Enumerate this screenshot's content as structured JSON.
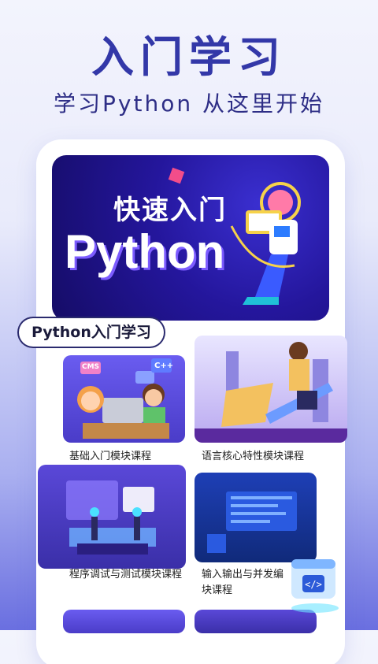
{
  "promo": {
    "title": "入门学习",
    "subtitle": "学习Python 从这里开始"
  },
  "hero": {
    "title_cn": "快速入门",
    "title_en": "Python"
  },
  "section": {
    "title": "Python入门学习"
  },
  "courses": [
    {
      "label": "基础入门模块课程",
      "badges": [
        "CMS",
        "C++",
        "C++",
        "C++"
      ]
    },
    {
      "label": "语言核心特性模块课程"
    },
    {
      "label": "程序调试与测试模块课程"
    },
    {
      "label": "输入输出与并发编块课程"
    }
  ],
  "colors": {
    "accent": "#3338a8",
    "hero_bg": "#24169c",
    "text_dark": "#1a1a3a"
  }
}
